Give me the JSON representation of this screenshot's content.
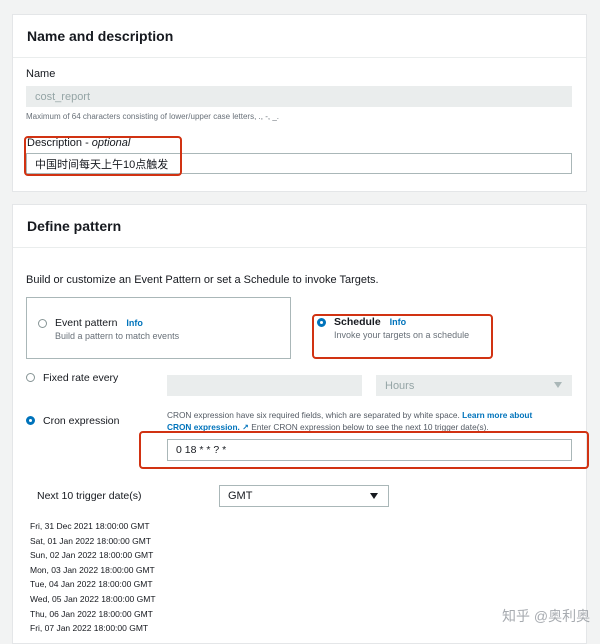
{
  "name_section": {
    "title": "Name and description",
    "name_label": "Name",
    "name_value": "cost_report",
    "name_hint": "Maximum of 64 characters consisting of lower/upper case letters, ., -, _.",
    "description_label": "Description - ",
    "description_optional": "optional",
    "description_value": "中国时间每天上午10点触发"
  },
  "pattern_section": {
    "title": "Define pattern",
    "intro": "Build or customize an Event Pattern or set a Schedule to invoke Targets.",
    "event_pattern": {
      "title": "Event pattern",
      "info": "Info",
      "desc": "Build a pattern to match events"
    },
    "schedule": {
      "title": "Schedule",
      "info": "Info",
      "desc": "Invoke your targets on a schedule"
    },
    "fixed_rate": {
      "label": "Fixed rate every",
      "unit": "Hours"
    },
    "cron": {
      "label": "Cron expression",
      "help_text": "CRON expression have six required fields, which are separated by white space.",
      "learn_more": "Learn more about",
      "learn_more_2": "CRON expression.",
      "help_tail": "Enter CRON expression below to see the next 10 trigger date(s).",
      "value": "0 18 * * ? *"
    },
    "next_triggers": {
      "label": "Next 10 trigger date(s)",
      "timezone": "GMT",
      "dates": [
        "Fri, 31 Dec 2021 18:00:00 GMT",
        "Sat, 01 Jan 2022 18:00:00 GMT",
        "Sun, 02 Jan 2022 18:00:00 GMT",
        "Mon, 03 Jan 2022 18:00:00 GMT",
        "Tue, 04 Jan 2022 18:00:00 GMT",
        "Wed, 05 Jan 2022 18:00:00 GMT",
        "Thu, 06 Jan 2022 18:00:00 GMT",
        "Fri, 07 Jan 2022 18:00:00 GMT"
      ]
    }
  },
  "watermark": "知乎 @奥利奥",
  "colors": {
    "accent": "#0073bb",
    "highlight": "#d13212"
  }
}
